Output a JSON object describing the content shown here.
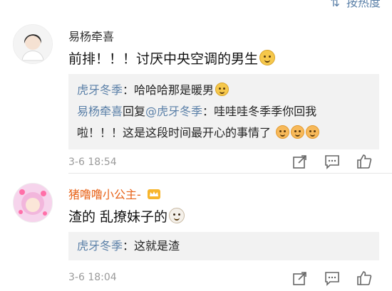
{
  "top": {
    "sort_label": "按热度",
    "sort_icon": "sort-icon"
  },
  "comments": [
    {
      "author": "易杨牵喜",
      "text": "前排！！！讨厌中央空调的男生",
      "replies": [
        {
          "user": "虎牙冬季",
          "sep": "：",
          "text": "哈哈哈那是暖男"
        },
        {
          "user": "易杨牵喜",
          "mid": "回复",
          "mention": "@虎牙冬季",
          "sep": "：",
          "text1": "哇哇哇冬季季你回我",
          "text2": "啦！！！这是这段时间最开心的事情了"
        }
      ],
      "time": "3-6 18:54"
    },
    {
      "author": "猪噜噜小公主-",
      "text": "渣的 乱撩妹子的",
      "replies": [
        {
          "user": "虎牙冬季",
          "sep": "：",
          "text": "这就是渣"
        }
      ],
      "time": "3-6 18:04"
    }
  ],
  "colors": {
    "link": "#5b80a8",
    "vip_name": "#e8641a",
    "meta": "#9a9a9a"
  }
}
